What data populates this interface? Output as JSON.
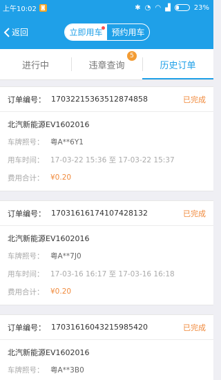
{
  "status_bar": {
    "time": "上午10:02",
    "battery": "23%"
  },
  "nav": {
    "back_label": "返回",
    "segments": [
      "立即用车",
      "预约用车"
    ]
  },
  "tabs": [
    {
      "label": "进行中"
    },
    {
      "label": "违章查询",
      "badge": "5"
    },
    {
      "label": "历史订单"
    }
  ],
  "labels": {
    "order_no": "订单编号：",
    "plate": "车牌照号：",
    "time": "用车时间：",
    "fee": "费用合计："
  },
  "orders": [
    {
      "order_no": "17032215363512874858",
      "status": "已完成",
      "car": "北汽新能源EV1602016",
      "plate": "粤A**6Y1",
      "time": "17-03-22 15:36  至  17-03-22 15:37",
      "fee": "¥0.20"
    },
    {
      "order_no": "17031616174107428132",
      "status": "已完成",
      "car": "北汽新能源EV1602016",
      "plate": "粤A**7J0",
      "time": "17-03-16 16:17  至  17-03-16 16:18",
      "fee": "¥0.20"
    },
    {
      "order_no": "17031616043215985420",
      "status": "已完成",
      "car": "北汽新能源EV1602016",
      "plate": "粤A**3B0",
      "time": "",
      "fee": ""
    }
  ]
}
